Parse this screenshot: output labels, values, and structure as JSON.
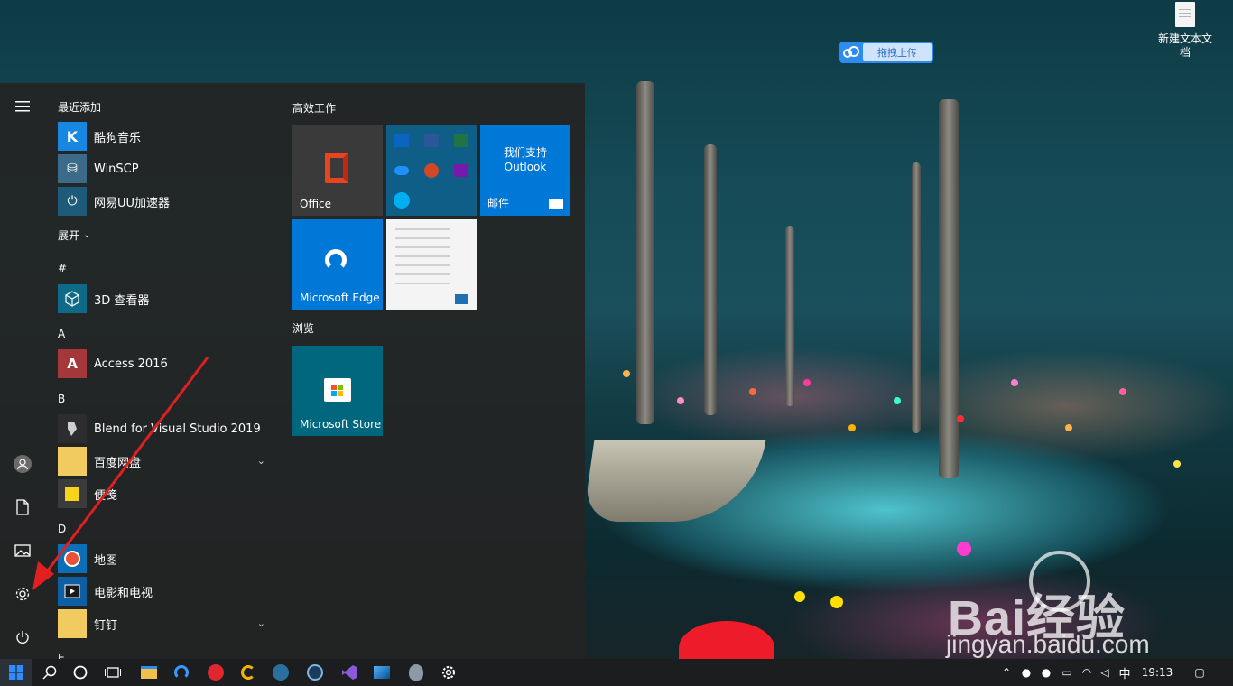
{
  "desktop": {
    "file_label": "新建文本文档",
    "upload_widget_label": "拖拽上传",
    "watermark": {
      "text": "Bai经验",
      "url": "jingyan.baidu.com"
    }
  },
  "start_menu": {
    "sections": {
      "recent": "最近添加",
      "expand": "展开",
      "hash": "#",
      "a": "A",
      "b": "B",
      "d": "D",
      "e": "E"
    },
    "recent_apps": [
      {
        "name": "酷狗音乐",
        "icon": "kugou-icon",
        "color": "#1787e2"
      },
      {
        "name": "WinSCP",
        "icon": "winscp-icon",
        "color": "#3c6b8a"
      },
      {
        "name": "网易UU加速器",
        "icon": "uu-accelerator-icon",
        "color": "#1e5a7a"
      }
    ],
    "apps": [
      {
        "name": "3D 查看器",
        "icon": "3d-viewer-icon",
        "color": "#0e6a87"
      },
      {
        "name": "Access 2016",
        "icon": "access-icon",
        "color": "#a4373a"
      },
      {
        "name": "Blend for Visual Studio 2019",
        "icon": "blend-icon",
        "color": "#2d2d30"
      },
      {
        "name": "百度网盘",
        "icon": "folder-icon",
        "color": "#f1cb5f"
      },
      {
        "name": "便笺",
        "icon": "sticky-notes-icon",
        "color": "#3b3b3b"
      },
      {
        "name": "地图",
        "icon": "maps-icon",
        "color": "#0b6fb7"
      },
      {
        "name": "电影和电视",
        "icon": "movies-tv-icon",
        "color": "#0d5ea3"
      },
      {
        "name": "钉钉",
        "icon": "folder-icon",
        "color": "#f1cb5f"
      }
    ],
    "tiles": {
      "group1": "高效工作",
      "group2": "浏览",
      "office": "Office",
      "outlook_text": "我们支持 Outlook",
      "mail": "邮件",
      "edge": "Microsoft Edge",
      "store": "Microsoft Store"
    }
  },
  "taskbar": {
    "ime": "中",
    "time": "19:13"
  },
  "colors": {
    "tile_blue": "#0078d7",
    "tile_gray": "#3a3a3a",
    "tile_teal": "#00677f",
    "arrow_red": "#e02020"
  }
}
